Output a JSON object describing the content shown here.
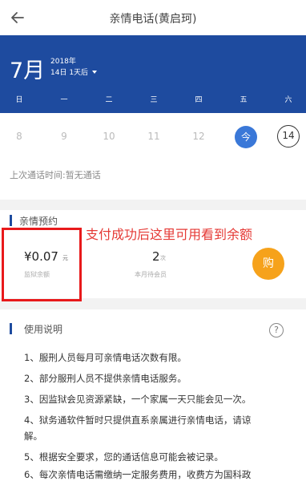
{
  "header": {
    "title": "亲情电话(黄启珂)",
    "back_icon": "arrow-left-icon"
  },
  "calendar": {
    "month": "7月",
    "year": "2018年",
    "day_label": "14日 1天后",
    "weekdays": [
      "日",
      "一",
      "二",
      "三",
      "四",
      "五",
      "六"
    ],
    "dates": [
      "8",
      "9",
      "10",
      "11",
      "12"
    ],
    "today_label": "今",
    "selected_date": "14",
    "header_color": "#1e4b9f"
  },
  "last_call": "上次通话时间:暂无通话",
  "package": {
    "title": "亲情预约",
    "overlay_note": "支付成功后这里可用看到余额",
    "balance": "¥0.07",
    "balance_unit": "元",
    "balance_label": "监狱余额",
    "count": "2",
    "count_unit": "次",
    "count_label": "本月待会员",
    "buy_label": "购",
    "buy_color": "#f6a21b"
  },
  "usage": {
    "title": "使用说明",
    "help_icon": "question-circle-icon",
    "rules": [
      "1、服刑人员每月可亲情电话次数有限。",
      "2、部分服刑人员不提供亲情电话服务。",
      "3、因监狱会见资源紧缺，一个家属一天只能会见一次。",
      "4、狱务通软件暂时只提供直系亲属进行亲情电话，请谅",
      "解。",
      "5、根据安全要求，您的通话信息可能会被记录。",
      "6、每次亲情电话需缴纳一定服务费用，收费方为国科政"
    ]
  }
}
